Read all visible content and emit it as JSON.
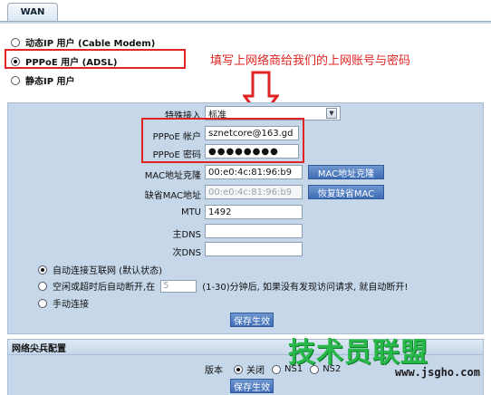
{
  "tab": {
    "label": "WAN"
  },
  "modes": [
    {
      "label": "动态IP 用户 (Cable Modem)",
      "selected": false
    },
    {
      "label": "PPPoE 用户 (ADSL)",
      "selected": true
    },
    {
      "label": "静态IP 用户",
      "selected": false
    }
  ],
  "annotation": "填写上网络商给我们的上网账号与密码",
  "fields": {
    "special_access": {
      "label": "特殊接入",
      "value": "标准"
    },
    "pppoe_account": {
      "label": "PPPoE 帐户",
      "value": "sznetcore@163.gd"
    },
    "pppoe_password": {
      "label": "PPPoE 密码",
      "value": "●●●●●●●●"
    },
    "mac_clone": {
      "label": "MAC地址克隆",
      "value": "00:e0:4c:81:96:b9",
      "button": "MAC地址克隆"
    },
    "default_mac": {
      "label": "缺省MAC地址",
      "value": "00:e0:4c:81:96:b9",
      "button": "恢复缺省MAC"
    },
    "mtu": {
      "label": "MTU",
      "value": "1492"
    },
    "primary_dns": {
      "label": "主DNS",
      "value": ""
    },
    "secondary_dns": {
      "label": "次DNS",
      "value": ""
    }
  },
  "connect_options": [
    {
      "label": "自动连接互联网 (默认状态)",
      "selected": true
    },
    {
      "label_before": "空闲或超时后自动断开,在",
      "input_value": "5",
      "label_after": "(1-30)分钟后, 如果没有发现访问请求, 就自动断开!",
      "selected": false
    },
    {
      "label": "手动连接",
      "selected": false
    }
  ],
  "save_label": "保存生效",
  "section2": {
    "title": "网络尖兵配置",
    "version_label": "版本",
    "options": [
      "关闭",
      "NS1",
      "NS2"
    ],
    "save_label": "保存生效"
  },
  "watermark": {
    "text": "技术员联盟",
    "url": "www.jsgho.com"
  }
}
